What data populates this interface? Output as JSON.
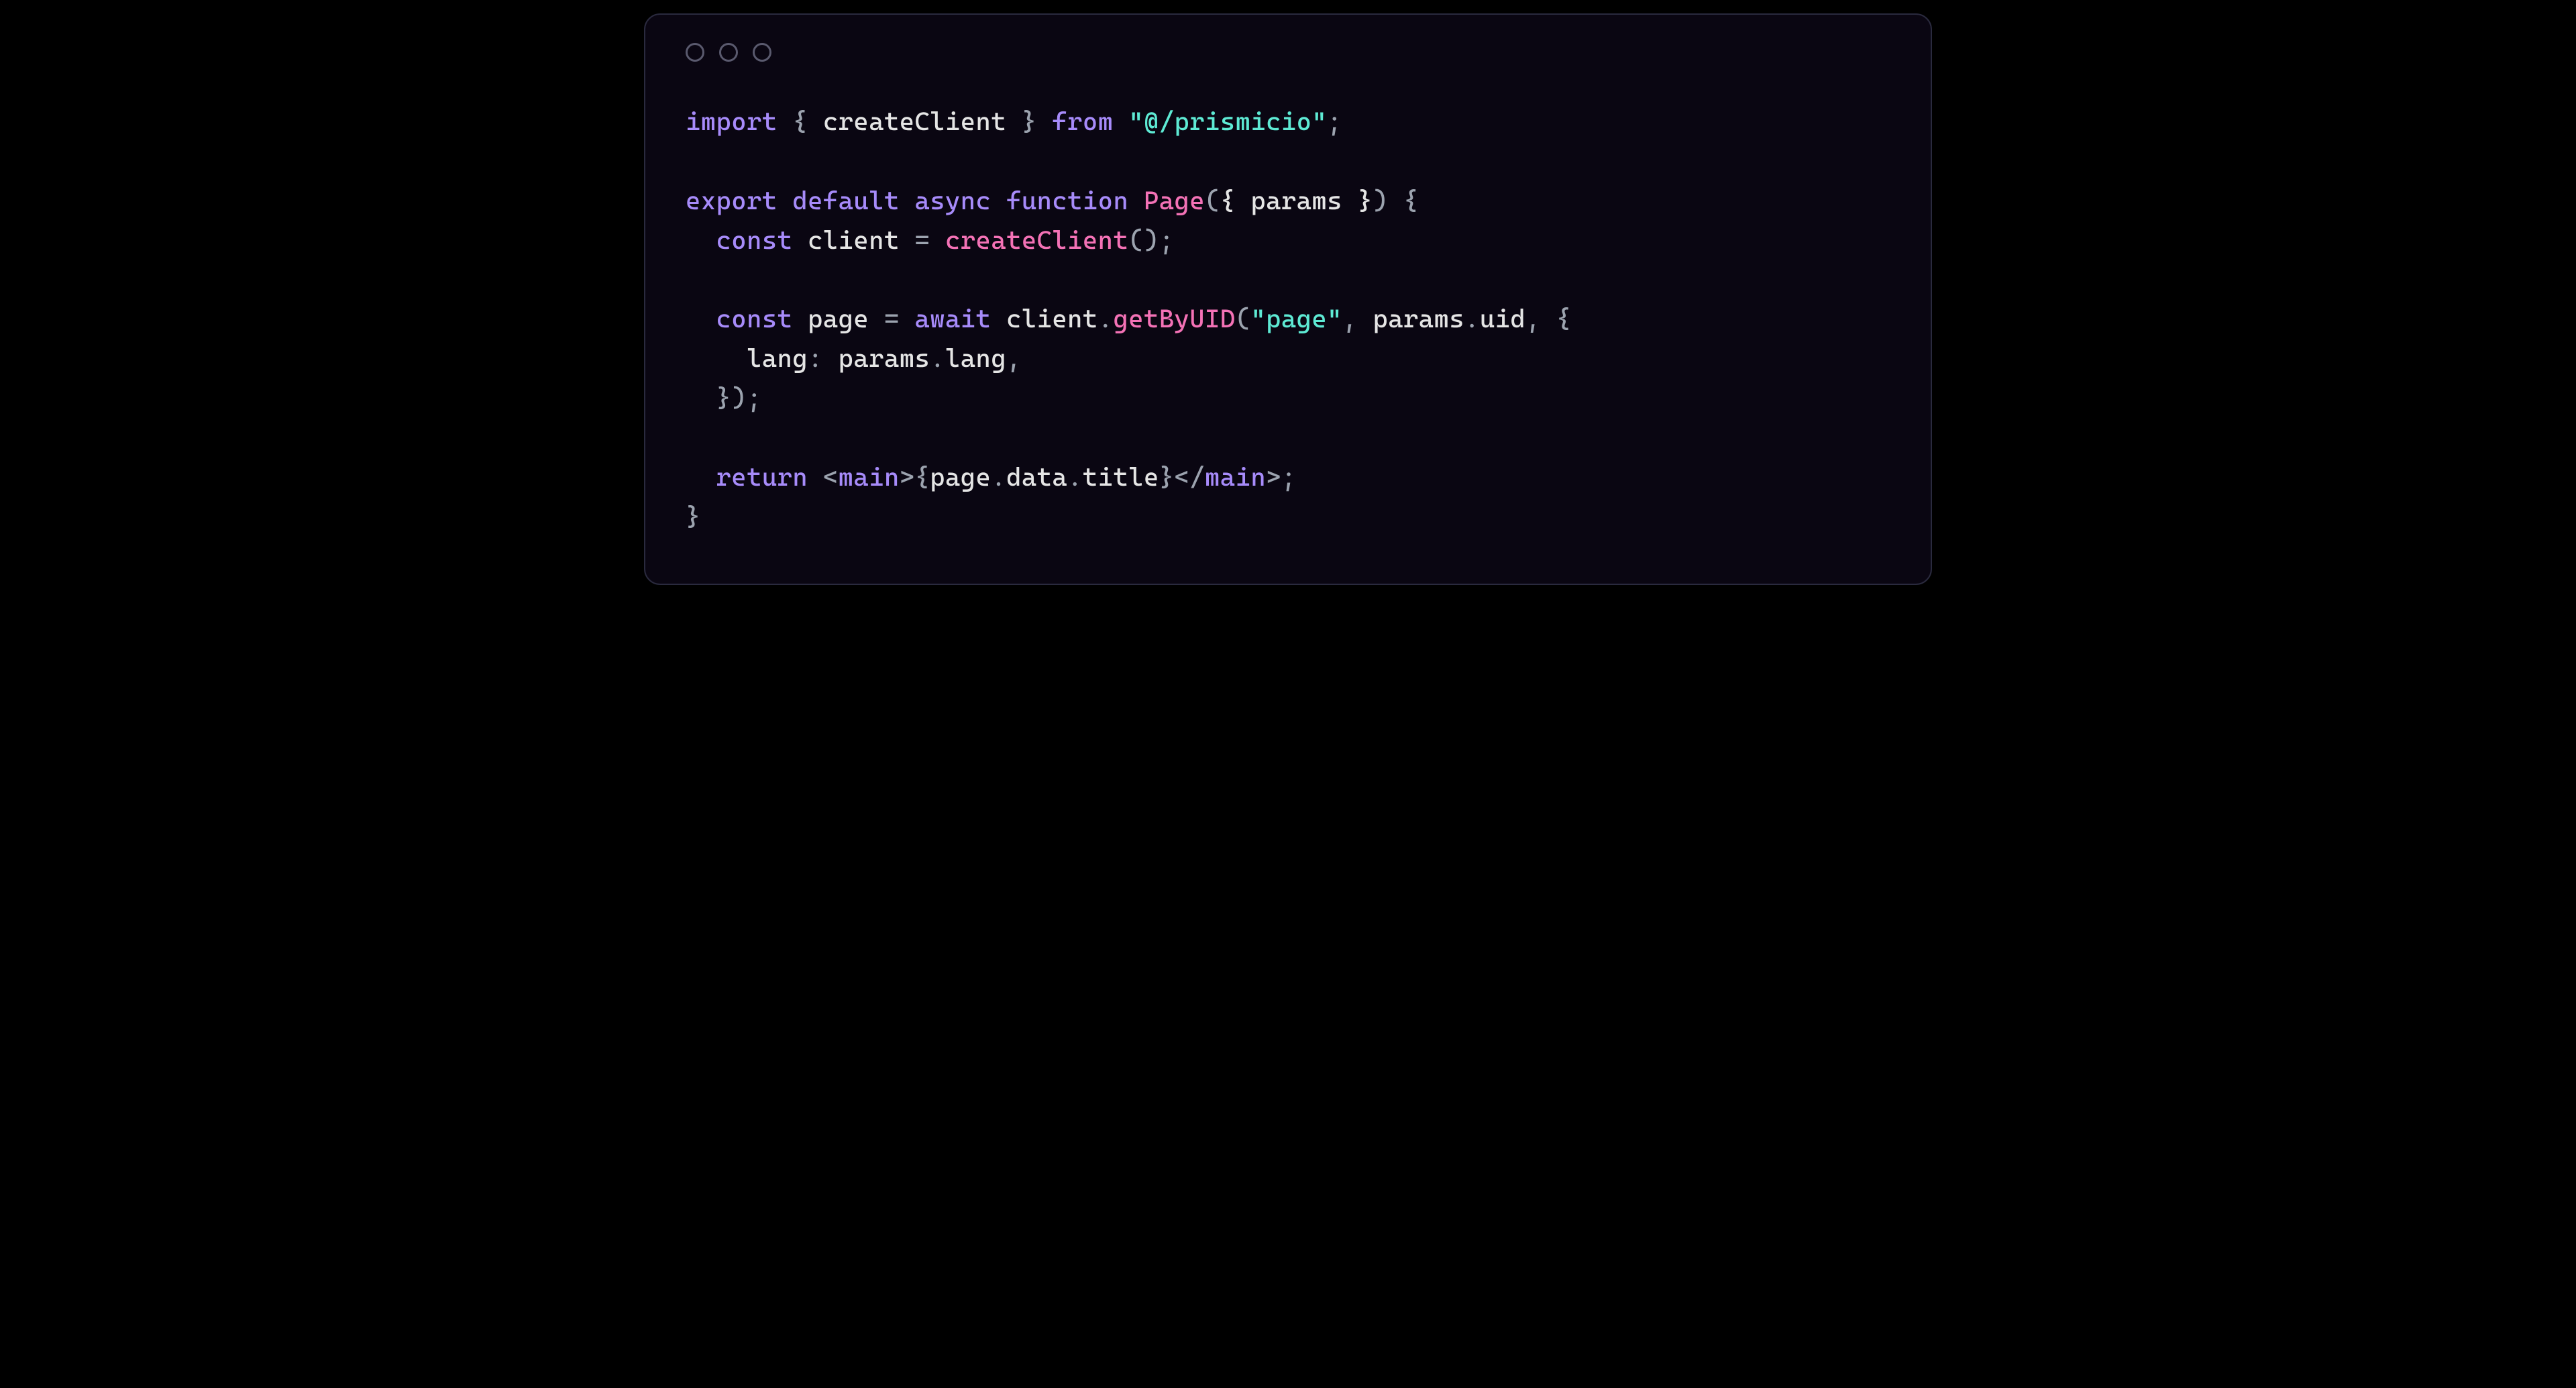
{
  "code": {
    "line1": {
      "import": "import",
      "brace_open": " { ",
      "createClient": "createClient",
      "brace_close": " } ",
      "from": "from",
      "space": " ",
      "string": "\"@/prismicio\"",
      "semi": ";"
    },
    "line3": {
      "export": "export",
      "space1": " ",
      "default": "default",
      "space2": " ",
      "async": "async",
      "space3": " ",
      "function": "function",
      "space4": " ",
      "name": "Page",
      "paren_open": "(",
      "destructure": "{ params }",
      "paren_close": ")",
      "space5": " ",
      "brace": "{"
    },
    "line4": {
      "indent": "  ",
      "const": "const",
      "space1": " ",
      "var": "client",
      "space2": " ",
      "eq": "=",
      "space3": " ",
      "call": "createClient",
      "parens": "()",
      "semi": ";"
    },
    "line6": {
      "indent": "  ",
      "const": "const",
      "space1": " ",
      "var": "page",
      "space2": " ",
      "eq": "=",
      "space3": " ",
      "await": "await",
      "space4": " ",
      "obj": "client",
      "dot": ".",
      "method": "getByUID",
      "paren_open": "(",
      "arg1": "\"page\"",
      "comma1": ", ",
      "arg2a": "params",
      "arg2dot": ".",
      "arg2b": "uid",
      "comma2": ", ",
      "brace": "{"
    },
    "line7": {
      "indent": "    ",
      "key": "lang",
      "colon": ": ",
      "val_obj": "params",
      "val_dot": ".",
      "val_prop": "lang",
      "comma": ","
    },
    "line8": {
      "indent": "  ",
      "close": "});"
    },
    "line10": {
      "indent": "  ",
      "return": "return",
      "space": " ",
      "jsx_open_bracket": "<",
      "jsx_tag": "main",
      "jsx_open_end": ">",
      "expr_open": "{",
      "expr_obj": "page",
      "expr_dot1": ".",
      "expr_data": "data",
      "expr_dot2": ".",
      "expr_title": "title",
      "expr_close": "}",
      "jsx_close_bracket": "</",
      "jsx_close_tag": "main",
      "jsx_close_end": ">",
      "semi": ";"
    },
    "line11": {
      "brace": "}"
    }
  }
}
